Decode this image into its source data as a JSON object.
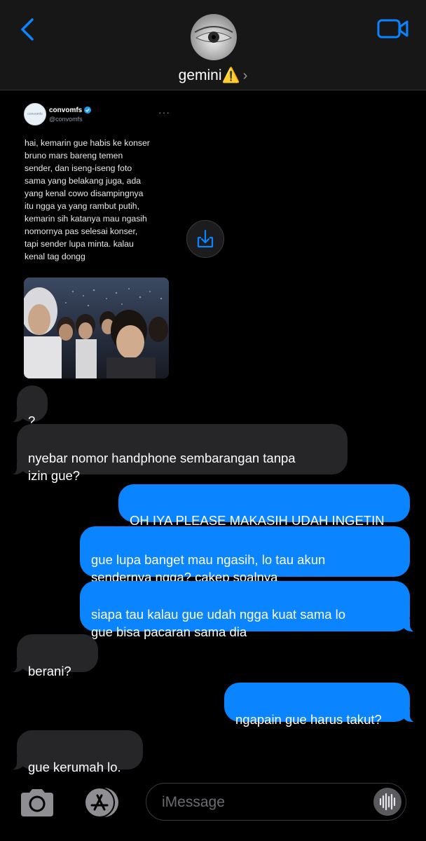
{
  "header": {
    "contact_name": "gemini⚠️",
    "chevron": "›",
    "back_icon": "chevron-left-icon",
    "video_icon": "video-camera-icon"
  },
  "tweet": {
    "account_name": "convomfs",
    "handle": "@convomfs",
    "avatar_text": "convomfs",
    "more": "···",
    "text": "hai, kemarin gue habis ke konser\nbruno mars bareng temen\nsender, dan iseng-iseng foto\nsama yang belakang juga, ada\nyang kenal cowo disampingnya\nitu ngga ya yang rambut putih,\nkemarin sih katanya mau ngasih\nnomornya pas selesai konser,\ntapi sender lupa minta. kalau\nkenal tag dongg"
  },
  "messages": [
    {
      "from": "them",
      "text": "?"
    },
    {
      "from": "them",
      "text": "nyebar nomor handphone sembarangan tanpa\nizin gue?"
    },
    {
      "from": "me",
      "text": "OH IYA PLEASE MAKASIH UDAH INGETIN"
    },
    {
      "from": "me",
      "text": "gue lupa banget mau ngasih, lo tau akun\nsendernya ngga? cakep soalnya"
    },
    {
      "from": "me",
      "text": "siapa tau kalau gue udah ngga kuat sama lo\ngue bisa pacaran sama dia"
    },
    {
      "from": "them",
      "text": "berani?"
    },
    {
      "from": "me",
      "text": "ngapain gue harus takut?"
    },
    {
      "from": "them",
      "text": "gue kerumah lo."
    }
  ],
  "composer": {
    "placeholder": "iMessage",
    "camera_icon": "camera-icon",
    "appstore_icon": "app-store-icon",
    "audio_icon": "audio-waveform-icon"
  },
  "colors": {
    "outgoing": "#0a84ff",
    "incoming": "#262629",
    "accent": "#0a84ff",
    "background": "#000000"
  }
}
